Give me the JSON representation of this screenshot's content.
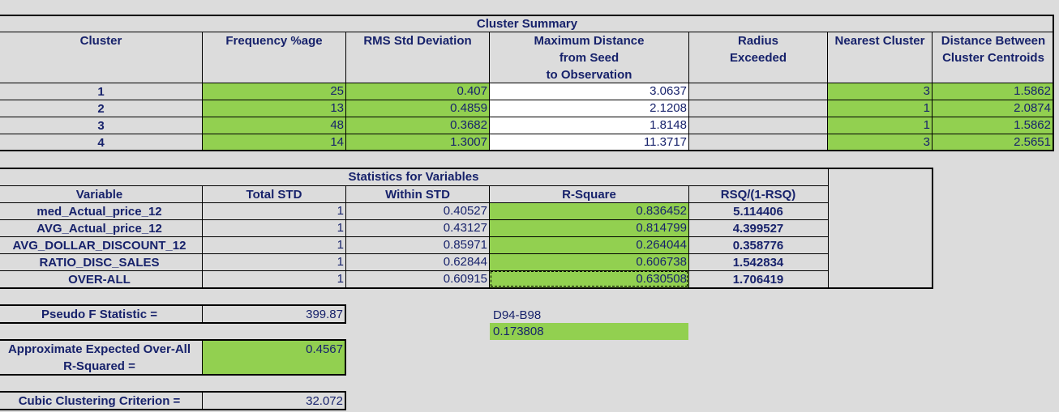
{
  "cluster_summary": {
    "title": "Cluster Summary",
    "headers": {
      "cluster": "Cluster",
      "frequency": "Frequency %age",
      "rms": "RMS Std Deviation",
      "maxdist_1": "Maximum Distance",
      "maxdist_2": "from Seed",
      "maxdist_3": "to Observation",
      "radius_1": "Radius",
      "radius_2": "Exceeded",
      "nearest": "Nearest Cluster",
      "dist_1": "Distance Between",
      "dist_2": "Cluster Centroids"
    },
    "rows": [
      {
        "cluster": "1",
        "frequency": "25",
        "rms": "0.407",
        "maxdist": "3.0637",
        "radius": "",
        "nearest": "3",
        "dist": "1.5862"
      },
      {
        "cluster": "2",
        "frequency": "13",
        "rms": "0.4859",
        "maxdist": "2.1208",
        "radius": "",
        "nearest": "1",
        "dist": "2.0874"
      },
      {
        "cluster": "3",
        "frequency": "48",
        "rms": "0.3682",
        "maxdist": "1.8148",
        "radius": "",
        "nearest": "1",
        "dist": "1.5862"
      },
      {
        "cluster": "4",
        "frequency": "14",
        "rms": "1.3007",
        "maxdist": "11.3717",
        "radius": "",
        "nearest": "3",
        "dist": "2.5651"
      }
    ]
  },
  "stats": {
    "title": "Statistics for Variables",
    "headers": {
      "variable": "Variable",
      "total": "Total STD",
      "within": "Within STD",
      "rsq": "R-Square",
      "ratio": "RSQ/(1-RSQ)"
    },
    "rows": [
      {
        "variable": "med_Actual_price_12",
        "total": "1",
        "within": "0.40527",
        "rsq": "0.836452",
        "ratio": "5.114406"
      },
      {
        "variable": "AVG_Actual_price_12",
        "total": "1",
        "within": "0.43127",
        "rsq": "0.814799",
        "ratio": "4.399527"
      },
      {
        "variable": "AVG_DOLLAR_DISCOUNT_12",
        "total": "1",
        "within": "0.85971",
        "rsq": "0.264044",
        "ratio": "0.358776"
      },
      {
        "variable": "RATIO_DISC_SALES",
        "total": "1",
        "within": "0.62844",
        "rsq": "0.606738",
        "ratio": "1.542834"
      },
      {
        "variable": "OVER-ALL",
        "total": "1",
        "within": "0.60915",
        "rsq": "0.630508",
        "ratio": "1.706419"
      }
    ]
  },
  "pseudo_f": {
    "label": "Pseudo F Statistic =",
    "value": "399.87"
  },
  "expected_rsq": {
    "label_1": "Approximate Expected Over-All",
    "label_2": "R-Squared =",
    "value": "0.4567"
  },
  "ccc": {
    "label": "Cubic Clustering Criterion =",
    "value": "32.072"
  },
  "formula": {
    "label": "D94-B98",
    "value": "0.173808"
  },
  "colors": {
    "green": "#92d050",
    "text": "#17226b",
    "background": "#dcdcdc"
  }
}
